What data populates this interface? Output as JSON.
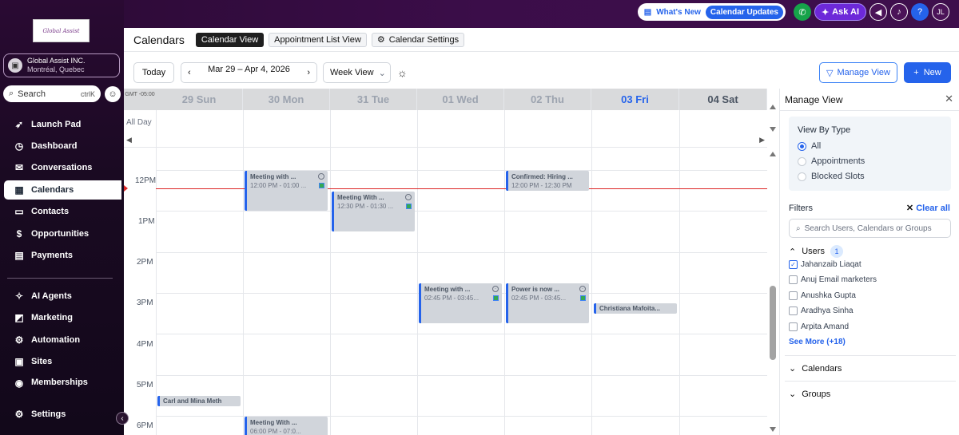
{
  "topbar": {
    "whats_new": "What's New",
    "calendar_updates": "Calendar Updates",
    "ask_ai": "Ask AI",
    "user_initials": "JL"
  },
  "sidebar": {
    "logo_text": "Global Assist",
    "account_name": "Global Assist INC.",
    "account_location": "Montréal, Quebec",
    "search_label": "Search",
    "search_shortcut": "ctrlK",
    "items": [
      {
        "label": "Launch Pad",
        "icon": "rocket-icon"
      },
      {
        "label": "Dashboard",
        "icon": "dashboard-icon"
      },
      {
        "label": "Conversations",
        "icon": "chat-icon"
      },
      {
        "label": "Calendars",
        "icon": "calendar-icon",
        "active": true
      },
      {
        "label": "Contacts",
        "icon": "contacts-icon"
      },
      {
        "label": "Opportunities",
        "icon": "opportunities-icon"
      },
      {
        "label": "Payments",
        "icon": "payments-icon"
      },
      {
        "label": "AI Agents",
        "icon": "sparkle-icon"
      },
      {
        "label": "Marketing",
        "icon": "megaphone-icon"
      },
      {
        "label": "Automation",
        "icon": "automation-icon"
      },
      {
        "label": "Sites",
        "icon": "sites-icon"
      },
      {
        "label": "Memberships",
        "icon": "memberships-icon"
      },
      {
        "label": "Settings",
        "icon": "gear-icon"
      }
    ]
  },
  "header": {
    "title": "Calendars",
    "tabs": [
      {
        "label": "Calendar View",
        "active": true
      },
      {
        "label": "Appointment List View"
      },
      {
        "label": "Calendar Settings"
      }
    ]
  },
  "toolbar": {
    "today": "Today",
    "date_range": "Mar 29 – Apr 4, 2026",
    "view_select": "Week View",
    "manage_view": "Manage View",
    "new": "New"
  },
  "calendar": {
    "timezone": "GMT -05:00",
    "all_day": "All Day",
    "days": [
      {
        "label": "29 Sun"
      },
      {
        "label": "30 Mon"
      },
      {
        "label": "31 Tue"
      },
      {
        "label": "01 Wed"
      },
      {
        "label": "02 Thu"
      },
      {
        "label": "03 Fri",
        "today": true
      },
      {
        "label": "04 Sat"
      }
    ],
    "hours": [
      "12PM",
      "1PM",
      "2PM",
      "3PM",
      "4PM",
      "5PM",
      "6PM"
    ],
    "events": [
      {
        "title": "Meeting with ...",
        "time": "12:00 PM - 01:00 ...",
        "day": "30 Mon"
      },
      {
        "title": "Meeting With ...",
        "time": "12:30 PM - 01:30 ...",
        "day": "31 Tue"
      },
      {
        "title": "Confirmed: Hiring ...",
        "time": "12:00 PM - 12:30 PM",
        "day": "02 Thu"
      },
      {
        "title": "Meeting with ...",
        "time": "02:45 PM - 03:45...",
        "day": "01 Wed"
      },
      {
        "title": "Power is now ...",
        "time": "02:45 PM - 03:45...",
        "day": "02 Thu"
      },
      {
        "title": "Christiana Mafoita...",
        "day": "03 Fri"
      },
      {
        "title": "Carl and Mina Meth",
        "day": "29 Sun"
      },
      {
        "title": "Meeting With ...",
        "time": "06:00 PM - 07:0...",
        "day": "30 Mon"
      }
    ]
  },
  "panel": {
    "title": "Manage View",
    "view_by_type": "View By Type",
    "types": [
      {
        "label": "All",
        "selected": true
      },
      {
        "label": "Appointments"
      },
      {
        "label": "Blocked Slots"
      }
    ],
    "filters": "Filters",
    "clear_all": "Clear all",
    "search_placeholder": "Search Users, Calendars or Groups",
    "users_label": "Users",
    "users_count": "1",
    "users": [
      {
        "name": "Jahanzaib Liaqat",
        "checked": true
      },
      {
        "name": "Anuj Email marketers"
      },
      {
        "name": "Anushka Gupta"
      },
      {
        "name": "Aradhya Sinha"
      },
      {
        "name": "Arpita Amand"
      }
    ],
    "see_more": "See More (+18)",
    "calendars_label": "Calendars",
    "groups_label": "Groups"
  }
}
